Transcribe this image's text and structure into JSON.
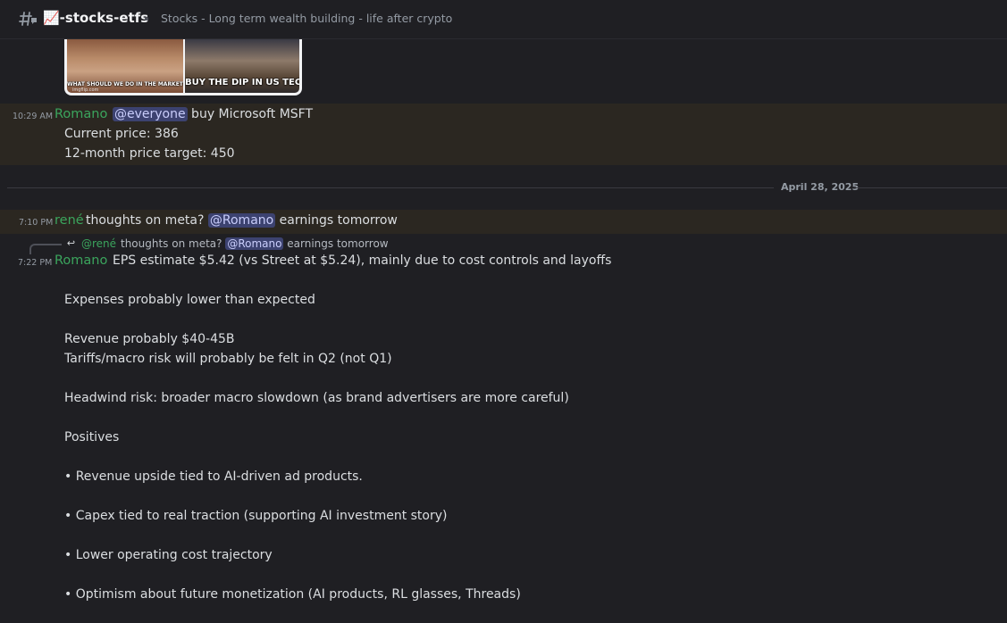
{
  "header": {
    "channel_name": "📈-stocks-etfs",
    "topic": "Stocks - Long term wealth building - life after crypto",
    "icon": "threaded-hash-icon"
  },
  "meme": {
    "left_caption": "WHAT SHOULD WE DO IN THE MARKETS?",
    "right_caption": "BUY THE DIP IN US TECH!",
    "credit": "imgflip.com"
  },
  "messages": [
    {
      "time": "10:29 AM",
      "author": "Romano",
      "mention": "@everyone",
      "first_line": " buy Microsoft MSFT",
      "lines": [
        "Current price: 386",
        "12-month price target: 450"
      ]
    }
  ],
  "divider": {
    "date": "April 28, 2025"
  },
  "rene_msg": {
    "time": "7:10 PM",
    "author": "rené",
    "text_before": " thoughts on meta? ",
    "mention": "@Romano",
    "text_after": " earnings tomorrow"
  },
  "reply": {
    "author": "@rené",
    "text_before": "thoughts on meta? ",
    "mention": "@Romano",
    "text_after": " earnings tomorrow"
  },
  "romano_msg": {
    "time": "7:22 PM",
    "author": "Romano",
    "first_line": "EPS estimate $5.42 (vs Street at $5.24), mainly due to cost controls and layoffs",
    "lines": [
      "Expenses probably lower than expected",
      "Revenue probably $40-45B",
      "Tariffs/macro risk will probably be felt in Q2 (not Q1)",
      "Headwind risk: broader macro slowdown (as brand advertisers are more careful)",
      "Positives",
      "• Revenue upside tied to AI-driven ad products.",
      "• Capex tied to real traction (supporting AI investment story)",
      "• Lower operating cost trajectory",
      "• Optimism about future monetization (AI products, RL glasses, Threads)"
    ]
  }
}
